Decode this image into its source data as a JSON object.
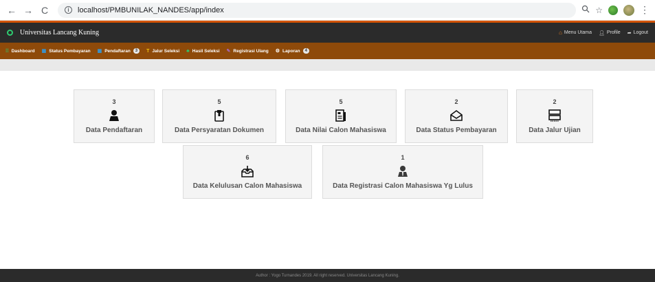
{
  "browser": {
    "url": "localhost/PMBUNILAK_NANDES/app/index"
  },
  "topbar": {
    "brand": "Universitas Lancang Kuning",
    "links": [
      "Menu Utama",
      "Profile",
      "Logout"
    ]
  },
  "menu": {
    "items": [
      {
        "label": "Dashboard",
        "icon": "grid-icon"
      },
      {
        "label": "Status Pembayaran",
        "icon": "table-icon"
      },
      {
        "label": "Pendaftaran",
        "icon": "table-icon",
        "badge": "3"
      },
      {
        "label": "Jalur Seleksi",
        "icon": "text-icon"
      },
      {
        "label": "Hasil Seleksi",
        "icon": "trophy-icon"
      },
      {
        "label": "Registrasi Ulang",
        "icon": "pencil-icon"
      },
      {
        "label": "Laporan",
        "icon": "gear-icon",
        "badge": "4"
      }
    ]
  },
  "cards": [
    {
      "count": "3",
      "title": "Data Pendaftaran",
      "icon": "user-icon"
    },
    {
      "count": "5",
      "title": "Data Persyaratan Dokumen",
      "icon": "clipboard-icon"
    },
    {
      "count": "5",
      "title": "Data Nilai Calon Mahasiswa",
      "icon": "document-icon"
    },
    {
      "count": "2",
      "title": "Data Status Pembayaran",
      "icon": "envelope-icon"
    },
    {
      "count": "2",
      "title": "Data Jalur Ujian",
      "icon": "server-icon"
    },
    {
      "count": "6",
      "title": "Data Kelulusan Calon Mahasiswa",
      "icon": "inbox-download-icon"
    },
    {
      "count": "1",
      "title": "Data Registrasi Calon Mahasiswa Yg Lulus",
      "icon": "user-tie-icon"
    }
  ],
  "footer": {
    "text": "Author : Yogo Turnandes 2019. All right reserved. Universitas Lancang Kuning."
  }
}
